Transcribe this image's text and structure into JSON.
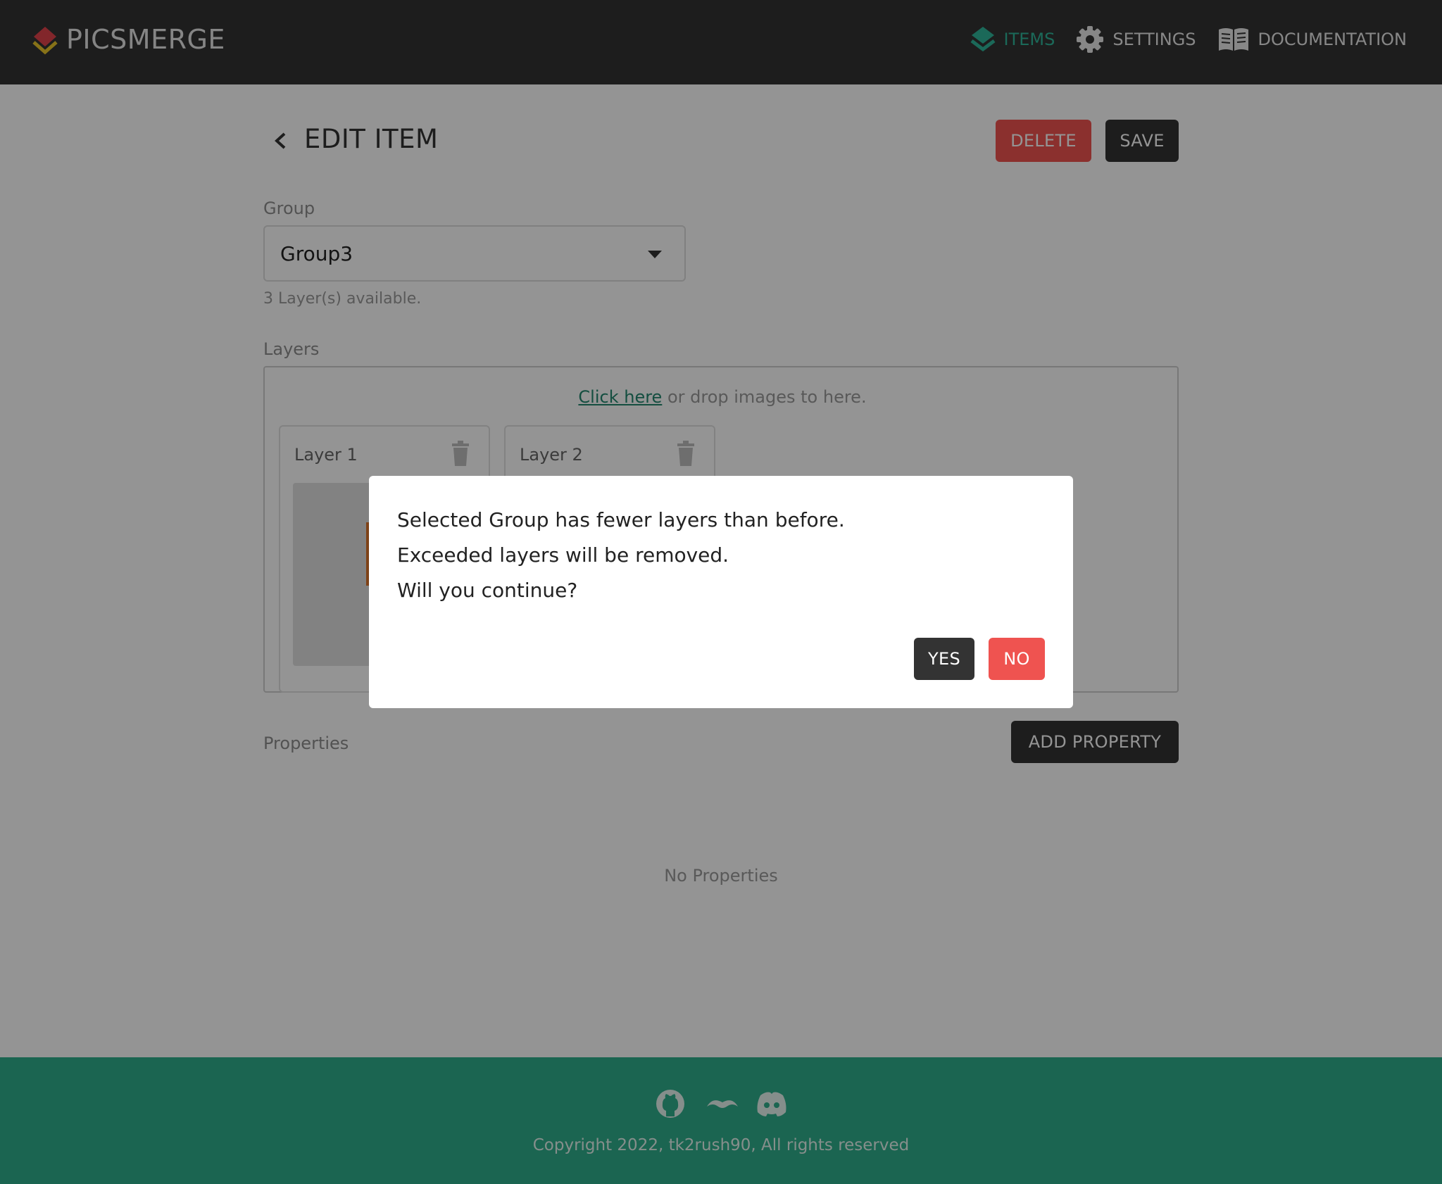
{
  "header": {
    "app_name": "PICSMERGE",
    "nav": [
      {
        "label": "ITEMS",
        "icon": "layers-icon",
        "active": true
      },
      {
        "label": "SETTINGS",
        "icon": "gear-icon",
        "active": false
      },
      {
        "label": "DOCUMENTATION",
        "icon": "book-icon",
        "active": false
      }
    ]
  },
  "page": {
    "title": "EDIT ITEM",
    "delete_label": "DELETE",
    "save_label": "SAVE"
  },
  "group": {
    "label": "Group",
    "selected": "Group3",
    "hint": "3 Layer(s) available."
  },
  "layers": {
    "label": "Layers",
    "upload_link": "Click here",
    "upload_text": " or drop images to here.",
    "items": [
      {
        "name": "Layer 1"
      },
      {
        "name": "Layer 2"
      }
    ]
  },
  "properties": {
    "label": "Properties",
    "add_label": "ADD PROPERTY",
    "empty_text": "No Properties"
  },
  "footer": {
    "copyright": "Copyright 2022, tk2rush90, All rights reserved"
  },
  "dialog": {
    "line1": "Selected Group has fewer layers than before.",
    "line2": "Exceeded layers will be removed.",
    "line3": "Will you continue?",
    "yes_label": "YES",
    "no_label": "NO"
  },
  "colors": {
    "header_bg": "#333333",
    "accent": "#2fb59a",
    "danger": "#ef5350",
    "footer_bg": "#2fae8c"
  }
}
